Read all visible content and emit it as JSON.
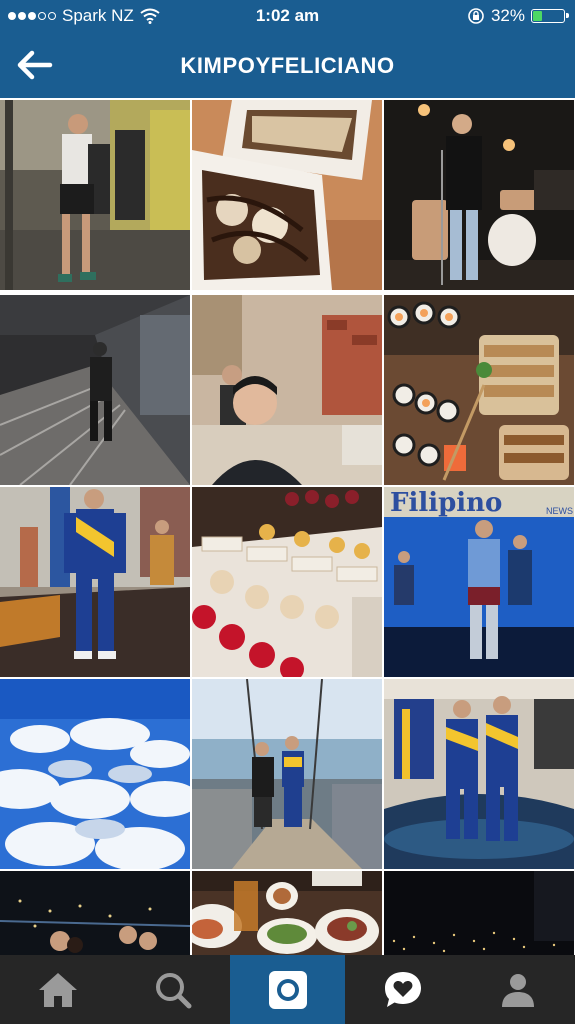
{
  "status_bar": {
    "carrier": "Spark NZ",
    "time": "1:02 am",
    "battery_percent": "32%",
    "battery_level": 0.32
  },
  "header": {
    "title": "KIMPOYFELICIANO",
    "back_icon": "arrow-left-icon"
  },
  "grid": {
    "photos": [
      "gym-selfie-photo",
      "chocolate-waffles-photo",
      "stage-singer-photo",
      "corridor-photo",
      "restaurant-selfie-photo",
      "sushi-platter-photo",
      "blue-jumpsuit-photo",
      "dessert-display-photo",
      "filipino-news-stage-photo",
      "clouds-aerial-photo",
      "skywalk-photo",
      "jumpsuit-duo-photo",
      "night-city-group-photo",
      "dinner-table-photo",
      "night-city-lights-photo"
    ],
    "banner_text": "Filipino",
    "banner_subtext": "NEWS"
  },
  "tabs": [
    {
      "name": "home-icon"
    },
    {
      "name": "search-icon"
    },
    {
      "name": "camera-icon",
      "active": true
    },
    {
      "name": "activity-heart-icon"
    },
    {
      "name": "profile-icon"
    }
  ],
  "colors": {
    "header": "#1a5d91",
    "tabbar": "#262626",
    "battery_fill": "#4cd964"
  }
}
